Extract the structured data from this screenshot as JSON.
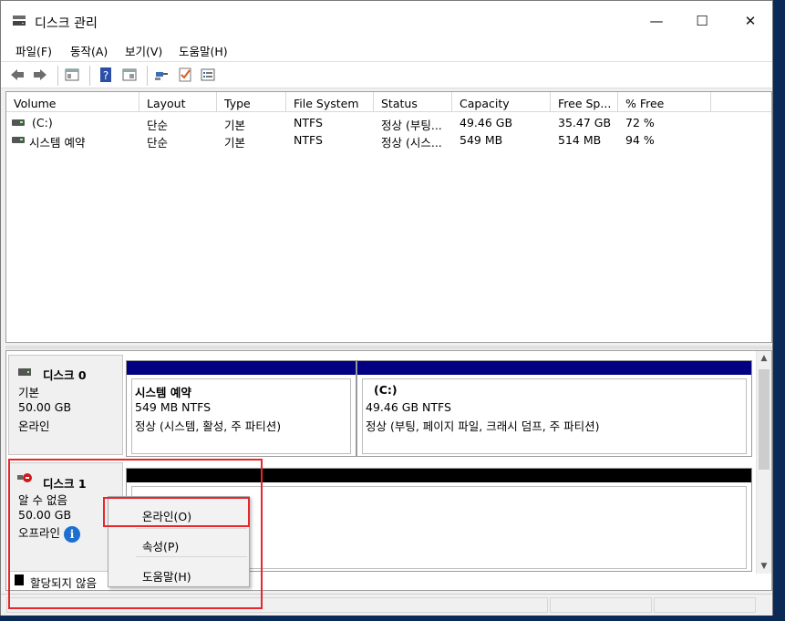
{
  "window": {
    "title": "디스크 관리",
    "controls": {
      "minimize": "—",
      "maximize": "☐",
      "close": "✕"
    }
  },
  "menu": [
    "파일(F)",
    "동작(A)",
    "보기(V)",
    "도움말(H)"
  ],
  "list": {
    "columns": [
      "Volume",
      "Layout",
      "Type",
      "File System",
      "Status",
      "Capacity",
      "Free Sp...",
      "% Free"
    ],
    "rows": [
      {
        "volume": "(C:)",
        "layout": "단순",
        "type": "기본",
        "fs": "NTFS",
        "status": "정상 (부팅...",
        "capacity": "49.46 GB",
        "free": "35.47 GB",
        "pct": "72 %"
      },
      {
        "volume": "시스템 예약",
        "layout": "단순",
        "type": "기본",
        "fs": "NTFS",
        "status": "정상 (시스...",
        "capacity": "549 MB",
        "free": "514 MB",
        "pct": "94 %"
      }
    ]
  },
  "disk0": {
    "name": "디스크 0",
    "type": "기본",
    "size": "50.00 GB",
    "state": "온라인",
    "partitions": [
      {
        "name": "시스템 예약",
        "size": "549 MB NTFS",
        "status": "정상 (시스템, 활성, 주 파티션)"
      },
      {
        "name": "(C:)",
        "size": "49.46 GB NTFS",
        "status": "정상 (부팅, 페이지 파일, 크래시 덤프, 주 파티션)"
      }
    ]
  },
  "disk1": {
    "name": "디스크 1",
    "type": "알 수 없음",
    "size": "50.00 GB",
    "state": "오프라인",
    "info_icon": "i"
  },
  "context_menu": {
    "items": [
      "온라인(O)",
      "속성(P)",
      "도움말(H)"
    ]
  },
  "legend": {
    "unallocated": "할당되지 않음"
  },
  "colors": {
    "partition_bar": "#000080",
    "unallocated_bar": "#000000",
    "highlight": "#e8262b"
  }
}
